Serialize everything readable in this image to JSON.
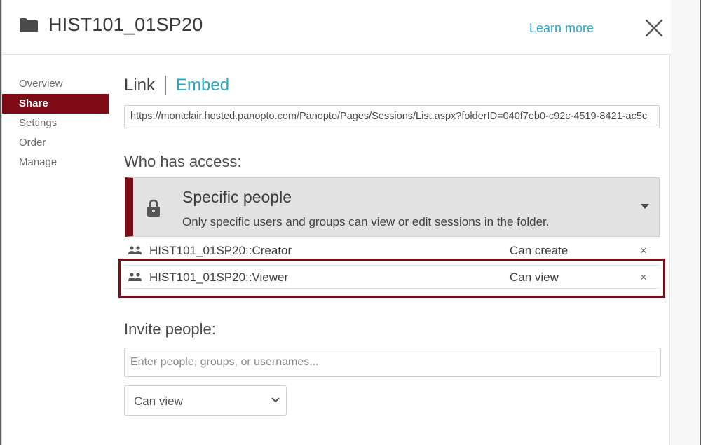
{
  "header": {
    "title": "HIST101_01SP20",
    "learn_more": "Learn more"
  },
  "sidenav": {
    "items": [
      {
        "label": "Overview"
      },
      {
        "label": "Share"
      },
      {
        "label": "Settings"
      },
      {
        "label": "Order"
      },
      {
        "label": "Manage"
      }
    ],
    "active": "Share"
  },
  "tabs": {
    "link": "Link",
    "embed": "Embed"
  },
  "share_link": "https://montclair.hosted.panopto.com/Panopto/Pages/Sessions/List.aspx?folderID=040f7eb0-c92c-4519-8421-ac5c",
  "access": {
    "heading": "Who has access:",
    "mode_title": "Specific people",
    "mode_description": "Only specific users and groups can view or edit sessions in the folder."
  },
  "permissions": [
    {
      "name": "HIST101_01SP20::Creator",
      "level": "Can create",
      "remove": "×"
    },
    {
      "name": "HIST101_01SP20::Viewer",
      "level": "Can view",
      "remove": "×"
    }
  ],
  "invite": {
    "heading": "Invite people:",
    "placeholder": "Enter people, groups, or usernames...",
    "value": "",
    "permission_selected": "Can view"
  },
  "colors": {
    "accent": "#7d0a14",
    "link": "#2aa6c8"
  },
  "icons": {
    "folder": "folder-icon",
    "close": "close-icon",
    "lock": "lock-icon",
    "group": "group-icon",
    "dropdown": "chevron-down-icon"
  }
}
